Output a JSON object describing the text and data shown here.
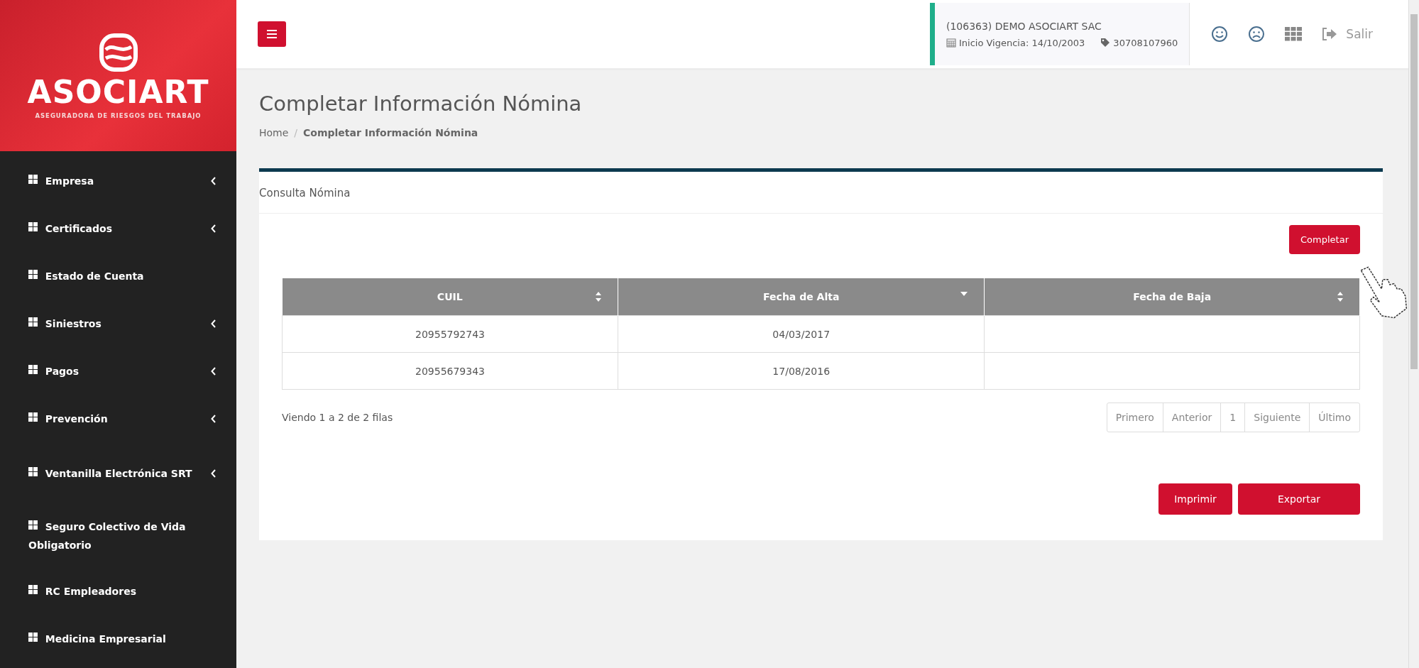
{
  "brand": {
    "name": "ASOCIART",
    "tagline": "ASEGURADORA DE RIESGOS DEL TRABAJO"
  },
  "sidebar": {
    "items": [
      {
        "label": "Empresa",
        "has_submenu": true
      },
      {
        "label": "Certificados",
        "has_submenu": true
      },
      {
        "label": "Estado de Cuenta",
        "has_submenu": false
      },
      {
        "label": "Siniestros",
        "has_submenu": true
      },
      {
        "label": "Pagos",
        "has_submenu": true
      },
      {
        "label": "Prevención",
        "has_submenu": true
      },
      {
        "label": "Ventanilla Electrónica SRT",
        "has_submenu": true
      },
      {
        "label": "Seguro Colectivo de Vida Obligatorio",
        "has_submenu": false
      },
      {
        "label": "RC Empleadores",
        "has_submenu": false
      },
      {
        "label": "Medicina Empresarial",
        "has_submenu": false
      }
    ]
  },
  "header": {
    "company": "(106363) DEMO ASOCIART SAC",
    "start_date": "Inicio Vigencia: 14/10/2003",
    "tax_id": "30708107960",
    "logout": "Salir"
  },
  "page": {
    "title": "Completar Información Nómina",
    "breadcrumb_separator": "/",
    "breadcrumb": [
      {
        "label": "Home",
        "current": false
      },
      {
        "label": "Completar Información Nómina",
        "current": true
      }
    ]
  },
  "panel": {
    "title": "Consulta Nómina",
    "action": "Completar",
    "table": {
      "columns": [
        {
          "label": "CUIL",
          "sorted": false
        },
        {
          "label": "Fecha de Alta",
          "sorted": true
        },
        {
          "label": "Fecha de Baja",
          "sorted": false
        }
      ],
      "rows": [
        [
          "20955792743",
          "04/03/2017",
          ""
        ],
        [
          "20955679343",
          "17/08/2016",
          ""
        ]
      ]
    },
    "summary": "Viendo 1 a 2 de 2 filas",
    "pagination": [
      "Primero",
      "Anterior",
      "1",
      "Siguiente",
      "Último"
    ],
    "buttons": [
      "Imprimir",
      "Exportar"
    ]
  }
}
